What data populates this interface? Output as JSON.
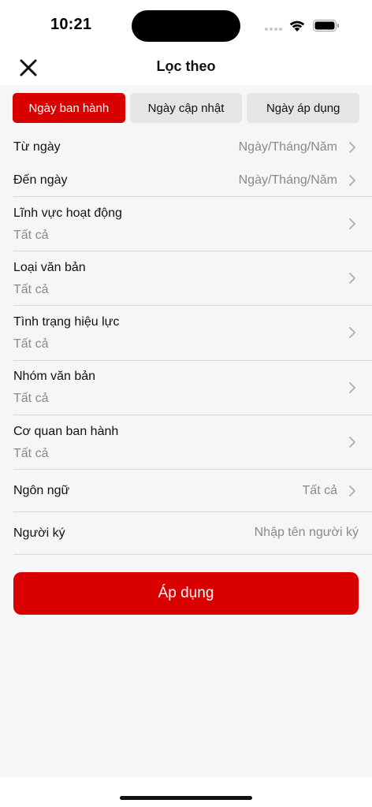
{
  "status_bar": {
    "time": "10:21"
  },
  "nav": {
    "title": "Lọc theo"
  },
  "tabs": [
    {
      "label": "Ngày ban hành",
      "active": true
    },
    {
      "label": "Ngày cập nhật",
      "active": false
    },
    {
      "label": "Ngày áp dụng",
      "active": false
    }
  ],
  "filters": {
    "from_date": {
      "label": "Từ ngày",
      "value": "Ngày/Tháng/Năm"
    },
    "to_date": {
      "label": "Đến ngày",
      "value": "Ngày/Tháng/Năm"
    },
    "field": {
      "label": "Lĩnh vực hoạt động",
      "value": "Tất cả"
    },
    "doc_type": {
      "label": "Loại văn bản",
      "value": "Tất cả"
    },
    "validity": {
      "label": "Tình trạng hiệu lực",
      "value": "Tất cả"
    },
    "doc_group": {
      "label": "Nhóm văn bản",
      "value": "Tất cả"
    },
    "issuer": {
      "label": "Cơ quan ban hành",
      "value": "Tất cả"
    },
    "language": {
      "label": "Ngôn ngữ",
      "value": "Tất cả"
    },
    "signer": {
      "label": "Người ký",
      "value": "",
      "placeholder": "Nhập tên người ký"
    }
  },
  "apply": {
    "label": "Áp dụng"
  },
  "colors": {
    "accent": "#d90000",
    "tab_inactive": "#e5e5e5",
    "background": "#f6f6f6",
    "muted_text": "#8a8a8a"
  },
  "icons": {
    "close": "close-icon",
    "chevron": "chevron-right-icon",
    "wifi": "wifi-icon",
    "battery": "battery-icon",
    "signal": "cellular-signal-icon"
  }
}
